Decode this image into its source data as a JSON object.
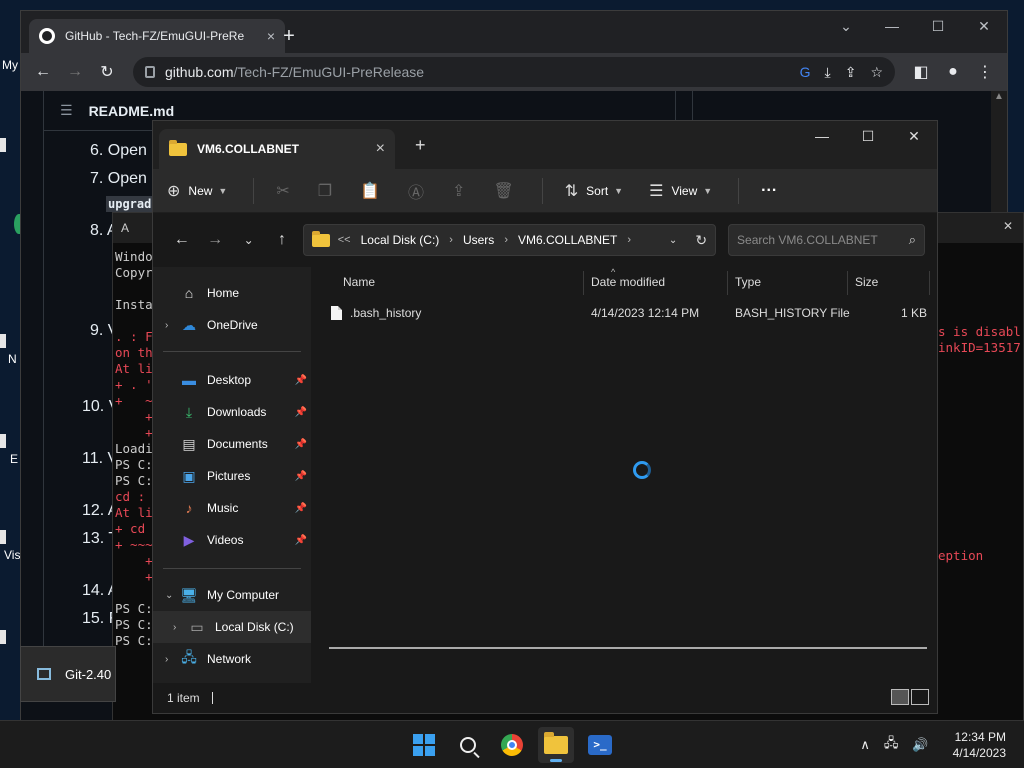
{
  "chrome": {
    "tab_title": "GitHub - Tech-FZ/EmuGUI-PreRe",
    "tab_close": "×",
    "new_tab": "+",
    "url_host": "github.com",
    "url_path": "/Tech-FZ/EmuGUI-PreRelease"
  },
  "desktop": {
    "label_my": "My",
    "label_n": "N",
    "label_e": "E",
    "label_vis": "Vis"
  },
  "github": {
    "readme_title": "README.md",
    "steps": [
      "6. Open",
      "7. Open",
      "upgrad",
      "8. A",
      "9. V",
      "10. V",
      "11. V",
      "12. A",
      "13. T",
      "14. A",
      "15. F"
    ]
  },
  "terminal": {
    "title": "A",
    "lines": [
      {
        "text": "Windo",
        "cls": "t-white"
      },
      {
        "text": "Copyr",
        "cls": "t-white"
      },
      {
        "text": "",
        "cls": "t-white"
      },
      {
        "text": "Insta",
        "cls": "t-white"
      },
      {
        "text": "",
        "cls": "t-white"
      },
      {
        "text": ". : F",
        "cls": "t-red"
      },
      {
        "text": "on th",
        "cls": "t-red"
      },
      {
        "text": "At li",
        "cls": "t-red"
      },
      {
        "text": "+ . '",
        "cls": "t-red"
      },
      {
        "text": "+   ~",
        "cls": "t-red"
      },
      {
        "text": "    +",
        "cls": "t-red"
      },
      {
        "text": "    +",
        "cls": "t-red"
      },
      {
        "text": "Loadi",
        "cls": "t-white"
      },
      {
        "text": "PS C:",
        "cls": "t-white"
      },
      {
        "text": "PS C:",
        "cls": "t-white"
      },
      {
        "text": "cd :",
        "cls": "t-red"
      },
      {
        "text": "At li",
        "cls": "t-red"
      },
      {
        "text": "+ cd",
        "cls": "t-red"
      },
      {
        "text": "+ ~~~",
        "cls": "t-red"
      },
      {
        "text": "    +",
        "cls": "t-red"
      },
      {
        "text": "    +",
        "cls": "t-red"
      },
      {
        "text": "",
        "cls": "t-white"
      },
      {
        "text": "PS C:",
        "cls": "t-white"
      },
      {
        "text": "PS C:",
        "cls": "t-white"
      },
      {
        "text": "PS C:",
        "cls": "t-white"
      }
    ],
    "right_1": "s is disabl",
    "right_2": "inkID=13517",
    "right_3": "eption"
  },
  "explorer": {
    "tab_title": "VM6.COLLABNET",
    "tab_close": "×",
    "new_tab": "+",
    "cmd_new": "New",
    "cmd_sort": "Sort",
    "cmd_view": "View",
    "cmd_more": "···",
    "crumbs": {
      "overflow": "<<",
      "c1": "Local Disk (C:)",
      "c2": "Users",
      "c3": "VM6.COLLABNET"
    },
    "search_placeholder": "Search VM6.COLLABNET",
    "nav": {
      "home": "Home",
      "onedrive": "OneDrive",
      "desktop": "Desktop",
      "downloads": "Downloads",
      "documents": "Documents",
      "pictures": "Pictures",
      "music": "Music",
      "videos": "Videos",
      "mycomputer": "My Computer",
      "localdisk": "Local Disk (C:)",
      "network": "Network"
    },
    "columns": {
      "name": "Name",
      "date": "Date modified",
      "type": "Type",
      "size": "Size"
    },
    "files": [
      {
        "name": ".bash_history",
        "date": "4/14/2023 12:14 PM",
        "type": "BASH_HISTORY File",
        "size": "1 KB"
      }
    ],
    "status": "1 item"
  },
  "git_tile": {
    "label": "Git-2.40"
  },
  "taskbar": {
    "time": "12:34 PM",
    "date": "4/14/2023"
  }
}
